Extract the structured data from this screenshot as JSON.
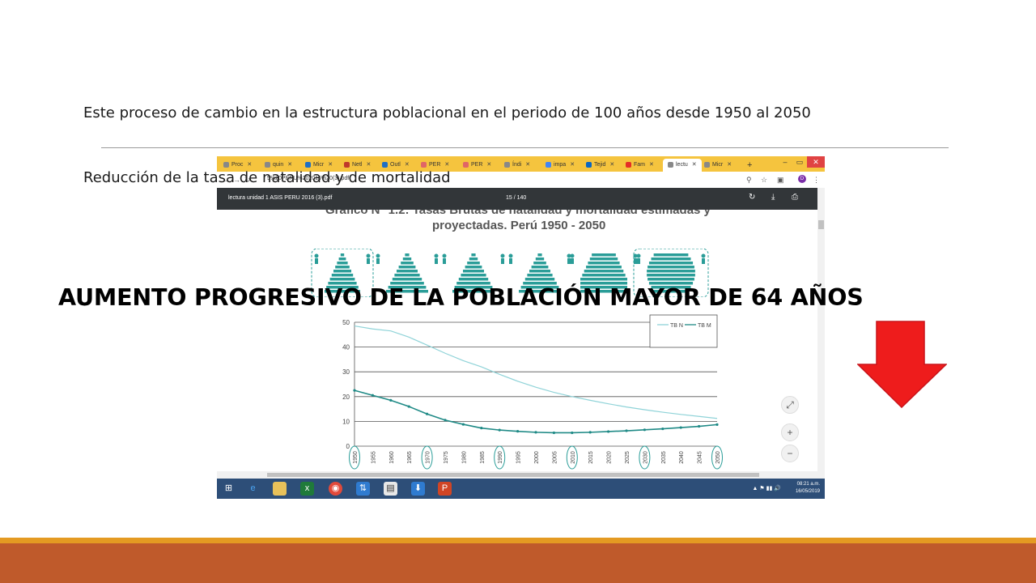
{
  "slide": {
    "line1": "Este proceso de cambio en la estructura poblacional en el periodo de 100 años desde 1950 al 2050",
    "line2": "Reducción de la tasa de natalidad y de mortalidad",
    "headline": "AUMENTO PROGRESIVO DE LA POBLACIÓN MAYOR DE 64 AÑOS",
    "arrow_color": "#ee1c1c",
    "band_colors": {
      "thin": "#e49a22",
      "band": "#bf5a2b"
    }
  },
  "browser": {
    "tabs": [
      {
        "label": "Proc",
        "icon": "globe-icon"
      },
      {
        "label": "quin",
        "icon": "globe-icon"
      },
      {
        "label": "Micr",
        "icon": "outlook-icon"
      },
      {
        "label": "Netl",
        "icon": "netlify-icon"
      },
      {
        "label": "Outl",
        "icon": "outlook-icon"
      },
      {
        "label": "PER",
        "icon": "pdf-icon"
      },
      {
        "label": "PER",
        "icon": "pdf-icon"
      },
      {
        "label": "Índi",
        "icon": "globe-icon"
      },
      {
        "label": "impa",
        "icon": "google-icon"
      },
      {
        "label": "Tejid",
        "icon": "linkedin-icon"
      },
      {
        "label": "Fam",
        "icon": "youtube-icon"
      },
      {
        "label": "lectu",
        "icon": "globe-icon",
        "active": true
      },
      {
        "label": "Micr",
        "icon": "globe-icon"
      }
    ],
    "url_fragment": "5%20PERU%202016%20(3).pdf",
    "profile_initial": "D",
    "pdf_title": "lectura unidad 1 ASIS PERU 2016 (3).pdf",
    "pdf_page": "15 / 140"
  },
  "document": {
    "title_line1": "Gráfico N° 1.2: Tasas Brutas de natalidad y mortalidad estimadas y",
    "title_line2": "proyectadas. Perú 1950 - 2050"
  },
  "chart_data": {
    "type": "line",
    "x": [
      1950,
      1955,
      1960,
      1965,
      1970,
      1975,
      1980,
      1985,
      1990,
      1995,
      2000,
      2005,
      2010,
      2015,
      2020,
      2025,
      2030,
      2035,
      2040,
      2045,
      2050
    ],
    "series": [
      {
        "name": "TB N",
        "color": "#8fd3d8",
        "values": [
          48.5,
          47.3,
          46.5,
          44.0,
          40.8,
          37.5,
          34.5,
          32.0,
          29.0,
          26.2,
          23.8,
          21.7,
          20.0,
          18.5,
          17.1,
          15.8,
          14.7,
          13.7,
          12.8,
          12.0,
          11.2
        ]
      },
      {
        "name": "TB M",
        "color": "#1f8a86",
        "values": [
          22.5,
          20.5,
          18.5,
          16.0,
          13.0,
          10.5,
          8.8,
          7.3,
          6.5,
          6.0,
          5.6,
          5.4,
          5.4,
          5.6,
          5.9,
          6.2,
          6.6,
          7.0,
          7.5,
          8.0,
          8.7
        ]
      }
    ],
    "ylim": [
      0,
      50
    ],
    "yticks": [
      0,
      10,
      20,
      30,
      40,
      50
    ],
    "highlighted_years": [
      1950,
      1970,
      1990,
      2010,
      2030,
      2050
    ],
    "legend_position": "top-right",
    "grid": true
  },
  "taskbar": {
    "time": "08:21 a.m.",
    "date": "16/05/2019"
  }
}
